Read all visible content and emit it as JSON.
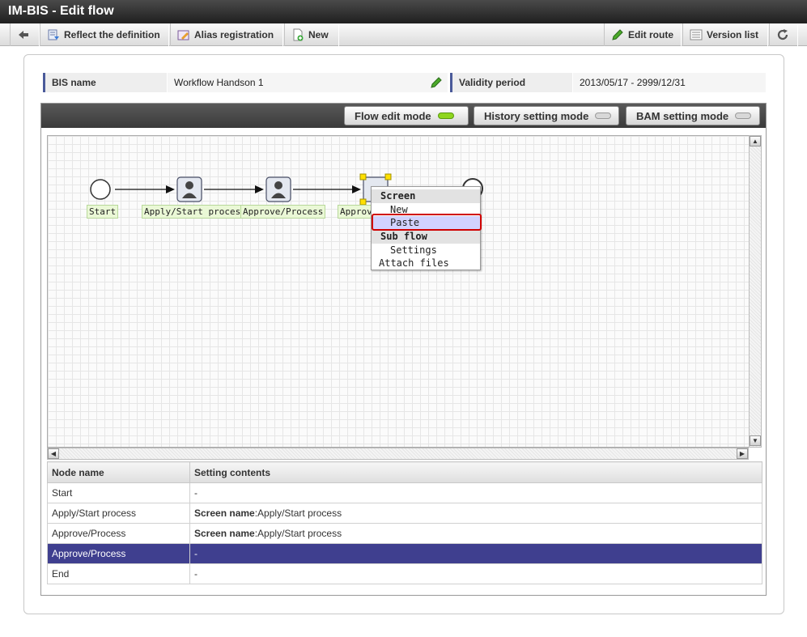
{
  "window": {
    "title": "IM-BIS - Edit flow"
  },
  "toolbar": {
    "reflect_label": "Reflect the definition",
    "alias_label": "Alias registration",
    "new_label": "New",
    "edit_route_label": "Edit route",
    "version_list_label": "Version list"
  },
  "info": {
    "bis_name_label": "BIS name",
    "bis_name_value": "Workflow Handson 1",
    "validity_label": "Validity period",
    "validity_value": "2013/05/17 - 2999/12/31"
  },
  "modes": {
    "flow_edit": "Flow edit mode",
    "history_setting": "History setting mode",
    "bam_setting": "BAM setting mode"
  },
  "flow": {
    "nodes": [
      "Start",
      "Apply/Start process",
      "Approve/Process",
      "Approve"
    ]
  },
  "context_menu": {
    "screen_header": "Screen",
    "new": "New",
    "paste": "Paste",
    "subflow_header": "Sub flow",
    "settings": "Settings",
    "attach_files": "Attach files"
  },
  "table": {
    "headers": [
      "Node name",
      "Setting contents"
    ],
    "screen_name_key": "Screen name",
    "rows": [
      {
        "node": "Start",
        "setting": "-"
      },
      {
        "node": "Apply/Start process",
        "setting": ":Apply/Start process"
      },
      {
        "node": "Approve/Process",
        "setting": ":Apply/Start process"
      },
      {
        "node": "Approve/Process",
        "setting": "-"
      },
      {
        "node": "End",
        "setting": "-"
      }
    ]
  },
  "colors": {
    "selected_row": "#3f3f8f",
    "mode_on": "#8fd61e",
    "highlight_box": "#d00000"
  }
}
